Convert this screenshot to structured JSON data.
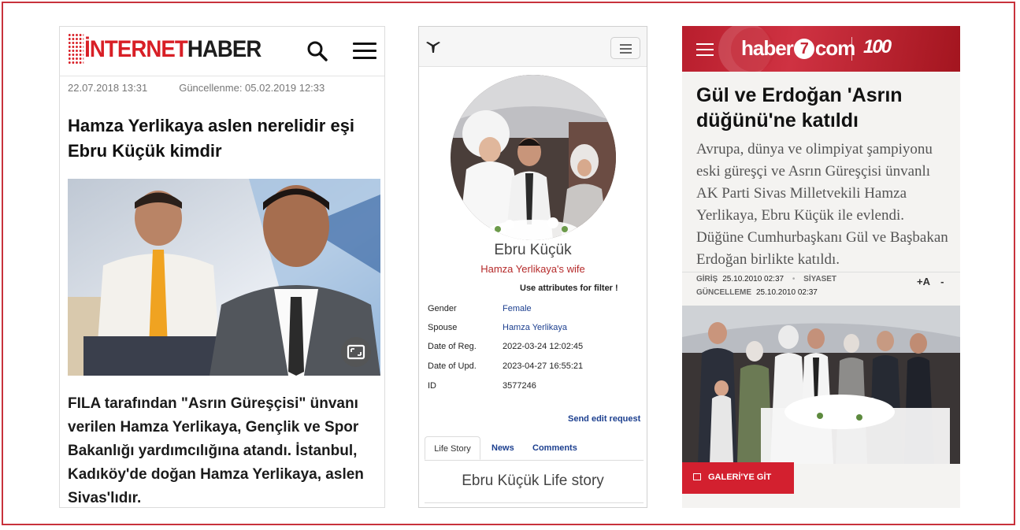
{
  "panel1": {
    "logo": {
      "red": "NTERNET",
      "dark": "HABER",
      "prefix": "İ"
    },
    "published": "22.07.2018 13:31",
    "updated": "Güncellenme: 05.02.2019 12:33",
    "title": "Hamza Yerlikaya aslen nerelidir eşi Ebru Küçük kimdir",
    "lead": "FILA tarafından \"Asrın Güreşçisi\" ünvanı verilen Hamza Yerlikaya, Gençlik ve Spor Bakanlığı yardımcılığına atandı. İstanbul, Kadıköy'de doğan Hamza Yerlikaya, aslen Sivas'lıdır.",
    "icons": [
      "search-icon",
      "menu-icon",
      "expand-icon"
    ],
    "accent": "#d81f26"
  },
  "panel2": {
    "name": "Ebru Küçük",
    "role": "Hamza Yerlikaya's wife",
    "filter_note": "Use attributes for filter !",
    "attributes": [
      {
        "label": "Gender",
        "value": "Female"
      },
      {
        "label": "Spouse",
        "value": "Hamza Yerlikaya"
      },
      {
        "label": "Date of Reg.",
        "value": "2022-03-24 12:02:45"
      },
      {
        "label": "Date of Upd.",
        "value": "2023-04-27 16:55:21"
      },
      {
        "label": "ID",
        "value": "3577246"
      }
    ],
    "edit_link": "Send edit request",
    "tabs": [
      "Life Story",
      "News",
      "Comments"
    ],
    "story_title": "Ebru Küçük Life story",
    "icons": [
      "brand-logo-icon",
      "menu-toggle-icon"
    ],
    "link_color": "#1c3f8f"
  },
  "panel3": {
    "brand": "haber7com",
    "brand_parts": {
      "a": "haber",
      "b": "7",
      "c": "com"
    },
    "anniversary": "100",
    "title": "Gül ve Erdoğan 'Asrın düğünü'ne katıldı",
    "summary": "Avrupa, dünya ve olimpiyat şampiyonu eski güreşçi ve Asrın Güreşçisi ünvanlı AK Parti Sivas Milletvekili Hamza Yerlikaya, Ebru Küçük ile evlendi. Düğüne Cumhurbaşkanı Gül ve Başbakan Erdoğan birlikte katıldı.",
    "entry_label": "GİRİŞ",
    "entry_date": "25.10.2010 02:37",
    "category": "SİYASET",
    "update_label": "GÜNCELLEME",
    "update_date": "25.10.2010 02:37",
    "font_controls": "+A -",
    "gallery_button": "GALERİ'YE GİT",
    "icons": [
      "menu-icon",
      "gallery-icon"
    ],
    "accent": "#d3202f"
  }
}
